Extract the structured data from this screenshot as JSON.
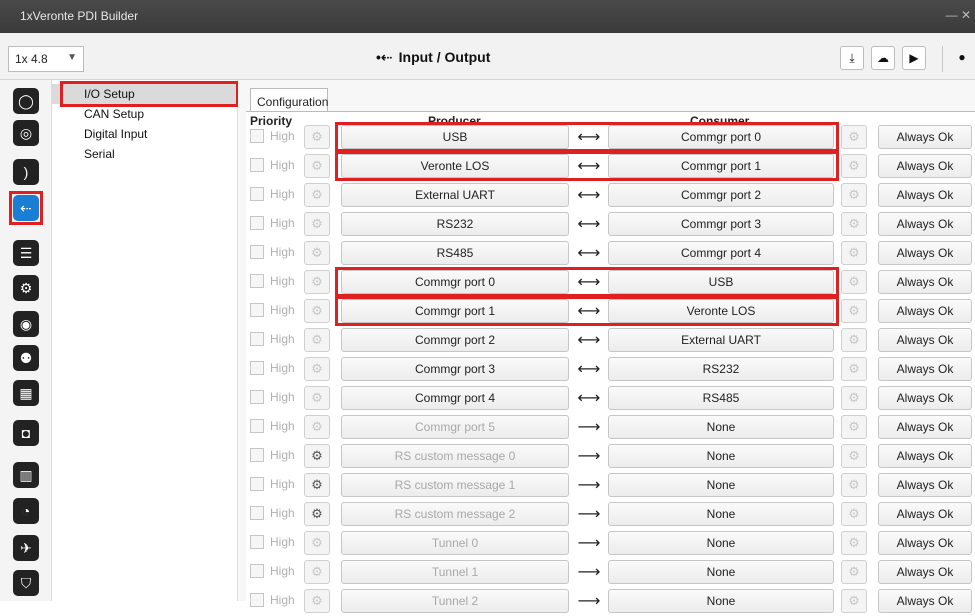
{
  "window": {
    "title": "1xVeronte PDI Builder"
  },
  "toolbar": {
    "version": "1x 4.8",
    "page_title": "Input / Output",
    "icons": [
      "download-icon",
      "cloud-upload-icon",
      "folder-open-icon",
      "info-icon"
    ]
  },
  "sidebar": {
    "icons": [
      "power-icon",
      "globe-icon",
      "rss-icon",
      "usb-icon",
      "sliders-icon",
      "gears-icon",
      "broadcast-icon",
      "gamepad-icon",
      "grid-icon",
      "camera-icon",
      "bar-chart-icon",
      "gauge-icon",
      "plane-icon",
      "shield-icon"
    ],
    "active": "usb-icon"
  },
  "subnav": {
    "items": [
      {
        "label": "I/O Setup",
        "selected": true
      },
      {
        "label": "CAN Setup"
      },
      {
        "label": "Digital Input"
      },
      {
        "label": "Serial"
      }
    ]
  },
  "config": {
    "tab_label": "Configuration",
    "col_priority": "Priority",
    "col_producer": "Producer",
    "col_consumer": "Consumer",
    "rows": [
      {
        "priority": "High",
        "producer": "USB",
        "consumer": "Commgr port 0",
        "status": "Always Ok",
        "bidir": true
      },
      {
        "priority": "High",
        "producer": "Veronte LOS",
        "consumer": "Commgr port 1",
        "status": "Always Ok",
        "bidir": true
      },
      {
        "priority": "High",
        "producer": "External UART",
        "consumer": "Commgr port 2",
        "status": "Always Ok",
        "bidir": true
      },
      {
        "priority": "High",
        "producer": "RS232",
        "consumer": "Commgr port 3",
        "status": "Always Ok",
        "bidir": true
      },
      {
        "priority": "High",
        "producer": "RS485",
        "consumer": "Commgr port 4",
        "status": "Always Ok",
        "bidir": true
      },
      {
        "priority": "High",
        "producer": "Commgr port 0",
        "consumer": "USB",
        "status": "Always Ok",
        "bidir": true
      },
      {
        "priority": "High",
        "producer": "Commgr port 1",
        "consumer": "Veronte LOS",
        "status": "Always Ok",
        "bidir": true
      },
      {
        "priority": "High",
        "producer": "Commgr port 2",
        "consumer": "External UART",
        "status": "Always Ok",
        "bidir": true
      },
      {
        "priority": "High",
        "producer": "Commgr port 3",
        "consumer": "RS232",
        "status": "Always Ok",
        "bidir": true
      },
      {
        "priority": "High",
        "producer": "Commgr port 4",
        "consumer": "RS485",
        "status": "Always Ok",
        "bidir": true
      },
      {
        "priority": "High",
        "producer": "Commgr port 5",
        "consumer": "None",
        "status": "Always Ok",
        "bidir": false
      },
      {
        "priority": "High",
        "producer": "RS custom message 0",
        "consumer": "None",
        "status": "Always Ok",
        "bidir": false
      },
      {
        "priority": "High",
        "producer": "RS custom message 1",
        "consumer": "None",
        "status": "Always Ok",
        "bidir": false
      },
      {
        "priority": "High",
        "producer": "RS custom message 2",
        "consumer": "None",
        "status": "Always Ok",
        "bidir": false
      },
      {
        "priority": "High",
        "producer": "Tunnel 0",
        "consumer": "None",
        "status": "Always Ok",
        "bidir": false
      },
      {
        "priority": "High",
        "producer": "Tunnel 1",
        "consumer": "None",
        "status": "Always Ok",
        "bidir": false
      },
      {
        "priority": "High",
        "producer": "Tunnel 2",
        "consumer": "None",
        "status": "Always Ok",
        "bidir": false
      }
    ]
  },
  "colors": {
    "highlight": "#e02020",
    "active_icon": "#1a7fd4"
  }
}
